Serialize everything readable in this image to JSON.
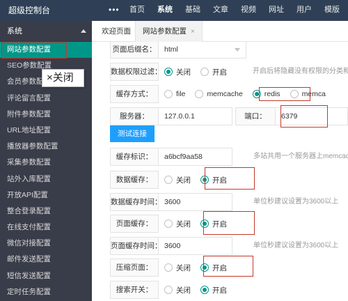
{
  "app": {
    "title": "超级控制台"
  },
  "nav": {
    "items": [
      "首页",
      "系统",
      "基础",
      "文章",
      "视频",
      "网址",
      "用户",
      "模版"
    ],
    "active_index": 1
  },
  "sidebar": {
    "section": "系统",
    "items": [
      "网站参数配置",
      "SEO参数配置",
      "会员参数配置",
      "评论留言配置",
      "附件参数配置",
      "URL地址配置",
      "播放器参数配置",
      "采集参数配置",
      "站外入库配置",
      "开放API配置",
      "整合登录配置",
      "在线支付配置",
      "微信对接配置",
      "邮件发送配置",
      "短信发送配置",
      "定时任务配置"
    ],
    "active_index": 0
  },
  "tooltip": {
    "close_label": "×关闭"
  },
  "tabs": {
    "welcome": "欢迎页面",
    "site_config": "网站参数配置",
    "close_glyph": "×"
  },
  "form": {
    "suffix": {
      "label": "页面后缀名：",
      "value": "html"
    },
    "permission_filter": {
      "label": "数据权限过滤：",
      "off": "关闭",
      "on": "开启",
      "hint": "开启后将隐藏没有权限的分类和"
    },
    "cache_mode": {
      "label": "缓存方式：",
      "options": [
        "file",
        "memcache",
        "redis",
        "memca"
      ],
      "selected": "redis"
    },
    "server": {
      "label": "服务器：",
      "value": "127.0.0.1",
      "port_label": "端口：",
      "port_value": "6379"
    },
    "test_button": "测试连接",
    "cache_id": {
      "label": "缓存标识：",
      "value": "a6bcf9aa58",
      "hint": "多站共用一个服务器上memcach"
    },
    "data_cache": {
      "label": "数据缓存：",
      "off": "关闭",
      "on": "开启",
      "selected": "on"
    },
    "data_cache_time": {
      "label": "数据缓存时间：",
      "value": "3600",
      "hint": "单位秒建议设置为3600以上"
    },
    "page_cache": {
      "label": "页面缓存：",
      "off": "关闭",
      "on": "开启",
      "selected": "on"
    },
    "page_cache_time": {
      "label": "页面缓存时间：",
      "value": "3600",
      "hint": "单位秒建议设置为3600以上"
    },
    "compress": {
      "label": "压缩页面：",
      "off": "关闭",
      "on": "开启",
      "selected": "on"
    },
    "search": {
      "label": "搜索开关：",
      "off": "关闭",
      "on": "开启",
      "selected": "on"
    }
  },
  "colors": {
    "topbar": "#2f4056",
    "sidebar": "#393d49",
    "accent": "#009688",
    "button": "#1e9fff",
    "highlight": "#c0392b"
  }
}
